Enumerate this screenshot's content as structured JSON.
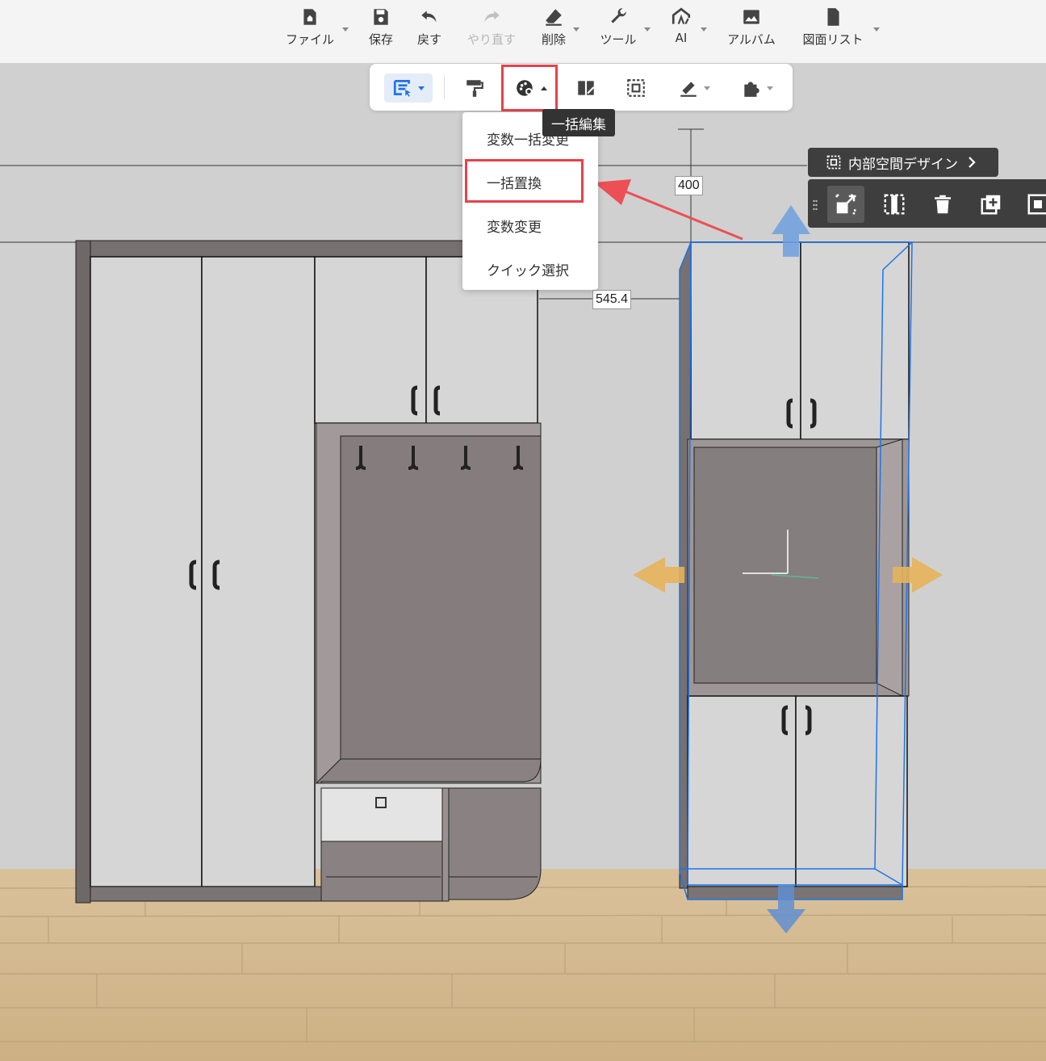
{
  "toolbar": {
    "file": "ファイル",
    "save": "保存",
    "undo": "戻す",
    "redo": "やり直す",
    "delete": "削除",
    "tools": "ツール",
    "ai": "AI",
    "album": "アルバム",
    "drawing_list": "図面リスト"
  },
  "batch_edit": {
    "tooltip": "一括編集",
    "menu": [
      "変数一括変更",
      "一括置換",
      "変数変更",
      "クイック選択"
    ]
  },
  "dimensions": {
    "height": "400",
    "distance": "545.4"
  },
  "selection_panel": {
    "interior_design": "内部空間デザイン"
  },
  "colors": {
    "accent": "#1e73e8",
    "highlight": "#e8414a",
    "panel": "#3e3e3e",
    "move_arrow_blue": "#6fa0de",
    "move_arrow_orange": "#e6b25a"
  }
}
